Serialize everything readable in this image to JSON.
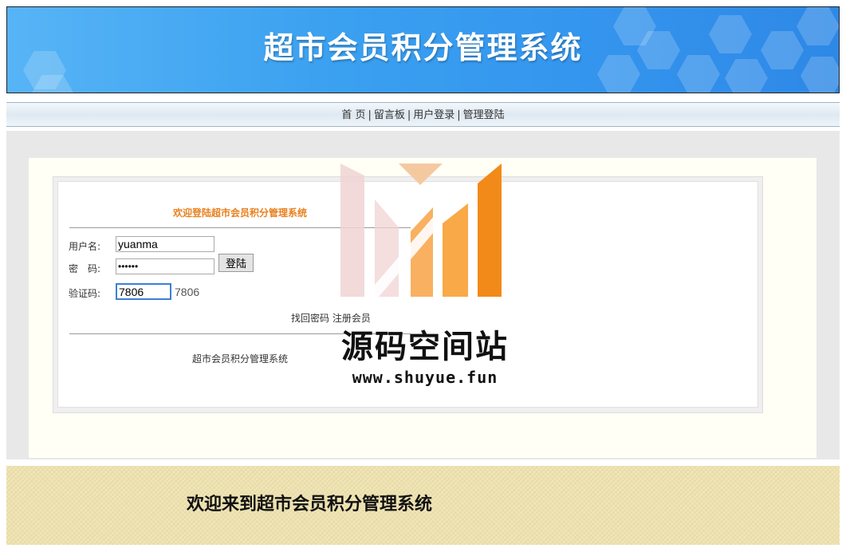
{
  "header": {
    "title": "超市会员积分管理系统"
  },
  "nav": {
    "items": [
      {
        "label": "首 页"
      },
      {
        "label": "留言板"
      },
      {
        "label": "用户登录"
      },
      {
        "label": "管理登陆"
      }
    ],
    "separator": "|"
  },
  "login": {
    "welcome": "欢迎登陆超市会员积分管理系统",
    "username_label": "用户名:",
    "username_value": "yuanma",
    "password_label": "密　码:",
    "password_value": "••••••",
    "captcha_label": "验证码:",
    "captcha_input_value": "7806",
    "captcha_code": "7806",
    "login_button": "登陆",
    "recover_password_link": "找回密码",
    "register_link": "注册会员",
    "box_footer": "超市会员积分管理系统"
  },
  "watermark": {
    "text": "源码空间站",
    "url": "www.shuyue.fun",
    "colors": {
      "peach": "#f5c9a0",
      "orange": "#f28a1a",
      "light_orange": "#f9b061",
      "pink": "#f0d3d3"
    }
  },
  "footer": {
    "text": "欢迎来到超市会员积分管理系统"
  },
  "colors": {
    "banner_blue": "#3aa0f0",
    "welcome_orange": "#e8801f",
    "footer_bg": "#eee2b0"
  }
}
